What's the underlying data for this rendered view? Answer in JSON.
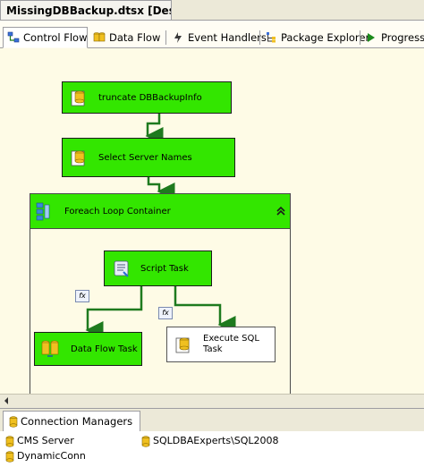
{
  "document_tab": {
    "title": "MissingDBBackup.dtsx [Design]"
  },
  "designer_tabs": [
    {
      "label": "Control Flow",
      "icon": "control-flow-icon",
      "active": true
    },
    {
      "label": "Data Flow",
      "icon": "data-flow-icon",
      "active": false
    },
    {
      "label": "Event Handlers",
      "icon": "event-handlers-icon",
      "active": false
    },
    {
      "label": "Package Explorer",
      "icon": "package-explorer-icon",
      "active": false
    },
    {
      "label": "Progress",
      "icon": "progress-icon",
      "active": false
    }
  ],
  "tasks": {
    "truncate": {
      "label": "truncate DBBackupInfo",
      "icon": "sql-task-icon"
    },
    "select_servers": {
      "label": "Select Server Names",
      "icon": "sql-task-icon"
    },
    "foreach": {
      "label": "Foreach Loop Container",
      "icon": "foreach-container-icon",
      "collapse_icon": "collapse-chevron-icon"
    },
    "script": {
      "label": "Script Task",
      "icon": "script-task-icon"
    },
    "data_flow": {
      "label": "Data Flow Task",
      "icon": "data-flow-task-icon"
    },
    "execute_sql": {
      "label_line1": "Execute SQL",
      "label_line2": "Task",
      "icon": "sql-task-icon"
    }
  },
  "expression_badges": [
    {
      "label": "fx"
    },
    {
      "label": "fx"
    }
  ],
  "connection_managers": {
    "tab_label": "Connection Managers",
    "items": [
      {
        "label": "CMS Server"
      },
      {
        "label": "SQLDBAExperts\\SQL2008"
      },
      {
        "label": "DynamicConn"
      }
    ]
  },
  "colors": {
    "task_green": "#33e600",
    "canvas": "#fefbe6",
    "connector": "#1e7a1e",
    "chrome": "#ece9d8"
  }
}
